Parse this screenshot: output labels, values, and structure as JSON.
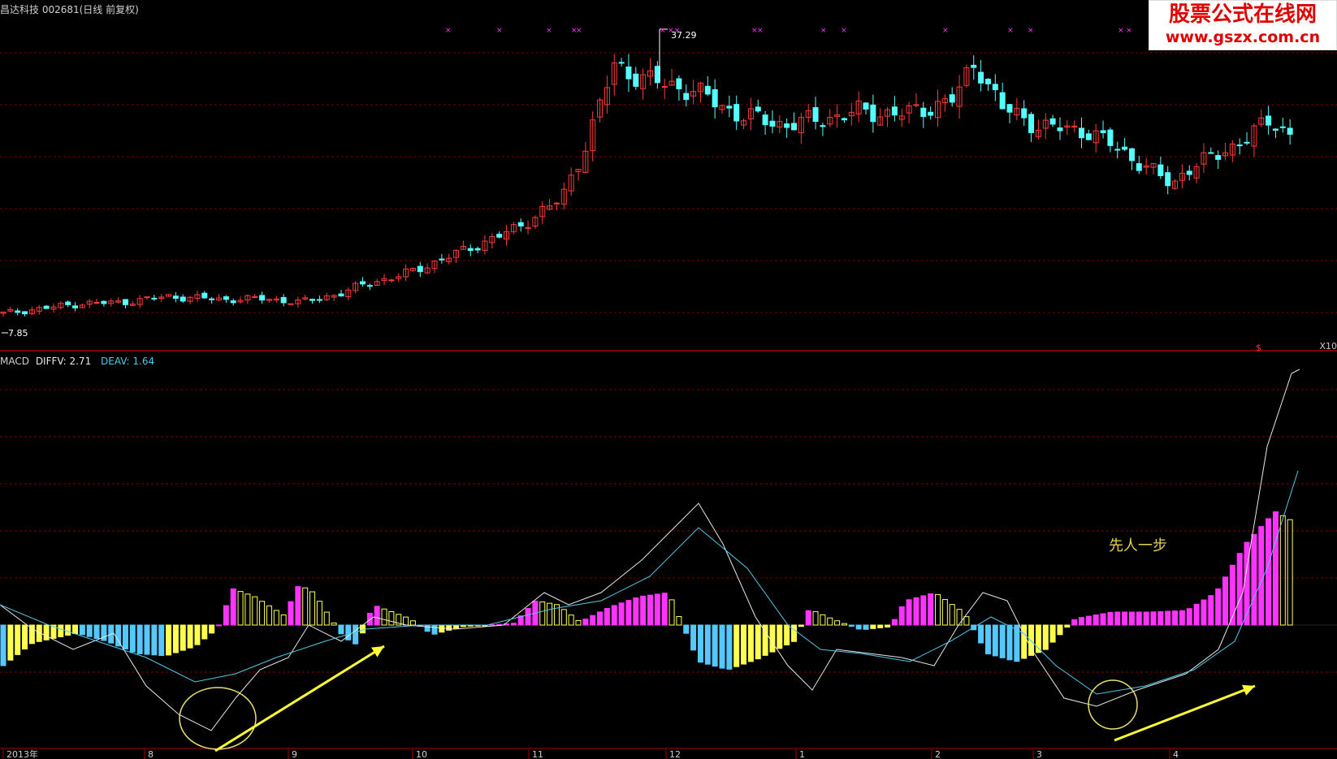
{
  "header": {
    "title": "昌达科技 002681(日线 前复权)",
    "corner_label": "X10"
  },
  "watermark": {
    "line1": "股票公式在线网",
    "line2": "www.gszx.com.cn"
  },
  "macd": {
    "label": "MACD",
    "dif_label": "DIFFV: 2.71",
    "dea_label": "DEAV: 1.64"
  },
  "annotation": "先人一步",
  "colors": {
    "background": "#000000",
    "grid": "#7a0000",
    "up_candle": "#ff3a3a",
    "down_candle": "#54ffff",
    "macd_pos": "#ff33ff",
    "macd_neg": "#54c8ff",
    "macd_pos_weak": "#ffff50",
    "dif_line": "#e8e8e8",
    "dea_line": "#53c8e8",
    "arrow": "#ffff33"
  },
  "chart_data": [
    {
      "type": "candlestick",
      "title": "昌达科技 002681(日线 前复权)",
      "x_ticks": [
        "2013年",
        "8",
        "9",
        "10",
        "11",
        "12",
        "1",
        "2",
        "3",
        "4"
      ],
      "annotations": [
        {
          "label": "37.29",
          "meaning": "period high"
        },
        {
          "label": "7.85",
          "meaning": "period low"
        }
      ],
      "price_range": [
        7.85,
        37.29
      ],
      "trend": "rises from 7.85 (Jul 2013) to 37.29 (Dec 2013), consolidates, second peak in Feb, pullback in Mar-Apr, recovery at end",
      "grid": true
    },
    {
      "type": "line+bar",
      "title": "MACD",
      "series": [
        {
          "name": "DIFFV",
          "last_value": 2.71
        },
        {
          "name": "DEAV",
          "last_value": 1.64
        }
      ],
      "annotation": "先人一步",
      "grid": true
    }
  ]
}
